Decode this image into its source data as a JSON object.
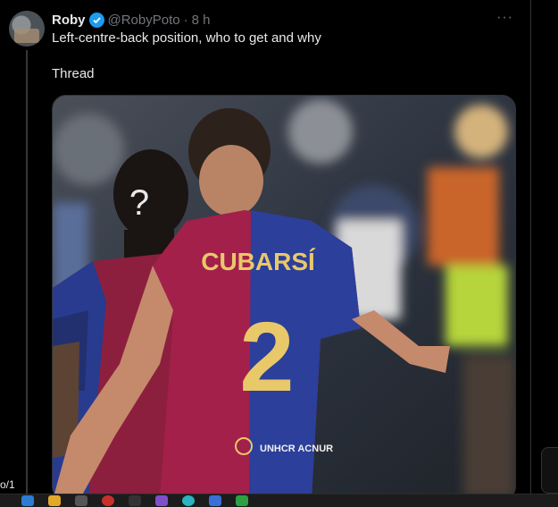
{
  "tweet": {
    "author_name": "Roby",
    "author_handle": "@RobyPoto",
    "separator": "·",
    "time": "8 h",
    "more_label": "···",
    "text_line1": "Left-centre-back position, who to get and why",
    "text_line2": "Thread",
    "media": {
      "jersey_name": "CUBARSÍ",
      "jersey_number": "2",
      "question_mark": "?",
      "sponsor_text": "UNHCR ACNUR"
    }
  },
  "left_snip": "o/1",
  "colors": {
    "background": "#000000",
    "text": "#e7e9ea",
    "muted": "#71767b",
    "verified": "#1d9bf0",
    "jersey_red": "#a3204a",
    "jersey_blue": "#2b3f9b",
    "jersey_gold": "#e9c86a"
  },
  "icons": [
    "verified-badge-icon",
    "more-options-icon"
  ]
}
